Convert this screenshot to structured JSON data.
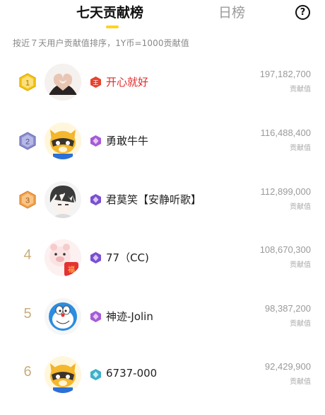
{
  "tabs": {
    "weekly": "七天贡献榜",
    "daily": "日榜",
    "help": "?"
  },
  "note": "按近７天用户贡献值排序，1Y币=1000贡献值",
  "colors": {
    "accent": "#ffd21f",
    "gold": "#f3c21a",
    "silver": "#8589c8",
    "bronze": "#f3a24a",
    "top_name": "#e22b2b"
  },
  "rows": [
    {
      "rank": "1",
      "name": "开心就好",
      "score": "197,182,700",
      "unit": "贡献值",
      "avatar": "heart-hands-avatar",
      "level_icon": "red-hex-level-icon"
    },
    {
      "rank": "2",
      "name": "勇敢牛牛",
      "score": "116,488,400",
      "unit": "贡献值",
      "avatar": "raccoon-mascot-avatar",
      "level_icon": "purple-hex-level-icon"
    },
    {
      "rank": "3",
      "name": "君莫笑【安静听歌】",
      "score": "112,899,000",
      "unit": "贡献值",
      "avatar": "anime-boy-avatar",
      "level_icon": "purple-hex-level-icon"
    },
    {
      "rank": "4",
      "name": "77（CC)",
      "score": "108,670,300",
      "unit": "贡献值",
      "avatar": "cartoon-pig-avatar",
      "level_icon": "purple-hex-level-icon"
    },
    {
      "rank": "5",
      "name": "神迹-Jolin",
      "score": "98,387,200",
      "unit": "贡献值",
      "avatar": "doraemon-avatar",
      "level_icon": "purple-hex-level-icon"
    },
    {
      "rank": "6",
      "name": "6737-000",
      "score": "92,429,900",
      "unit": "贡献值",
      "avatar": "raccoon-mascot-avatar",
      "level_icon": "teal-hex-level-icon"
    }
  ]
}
